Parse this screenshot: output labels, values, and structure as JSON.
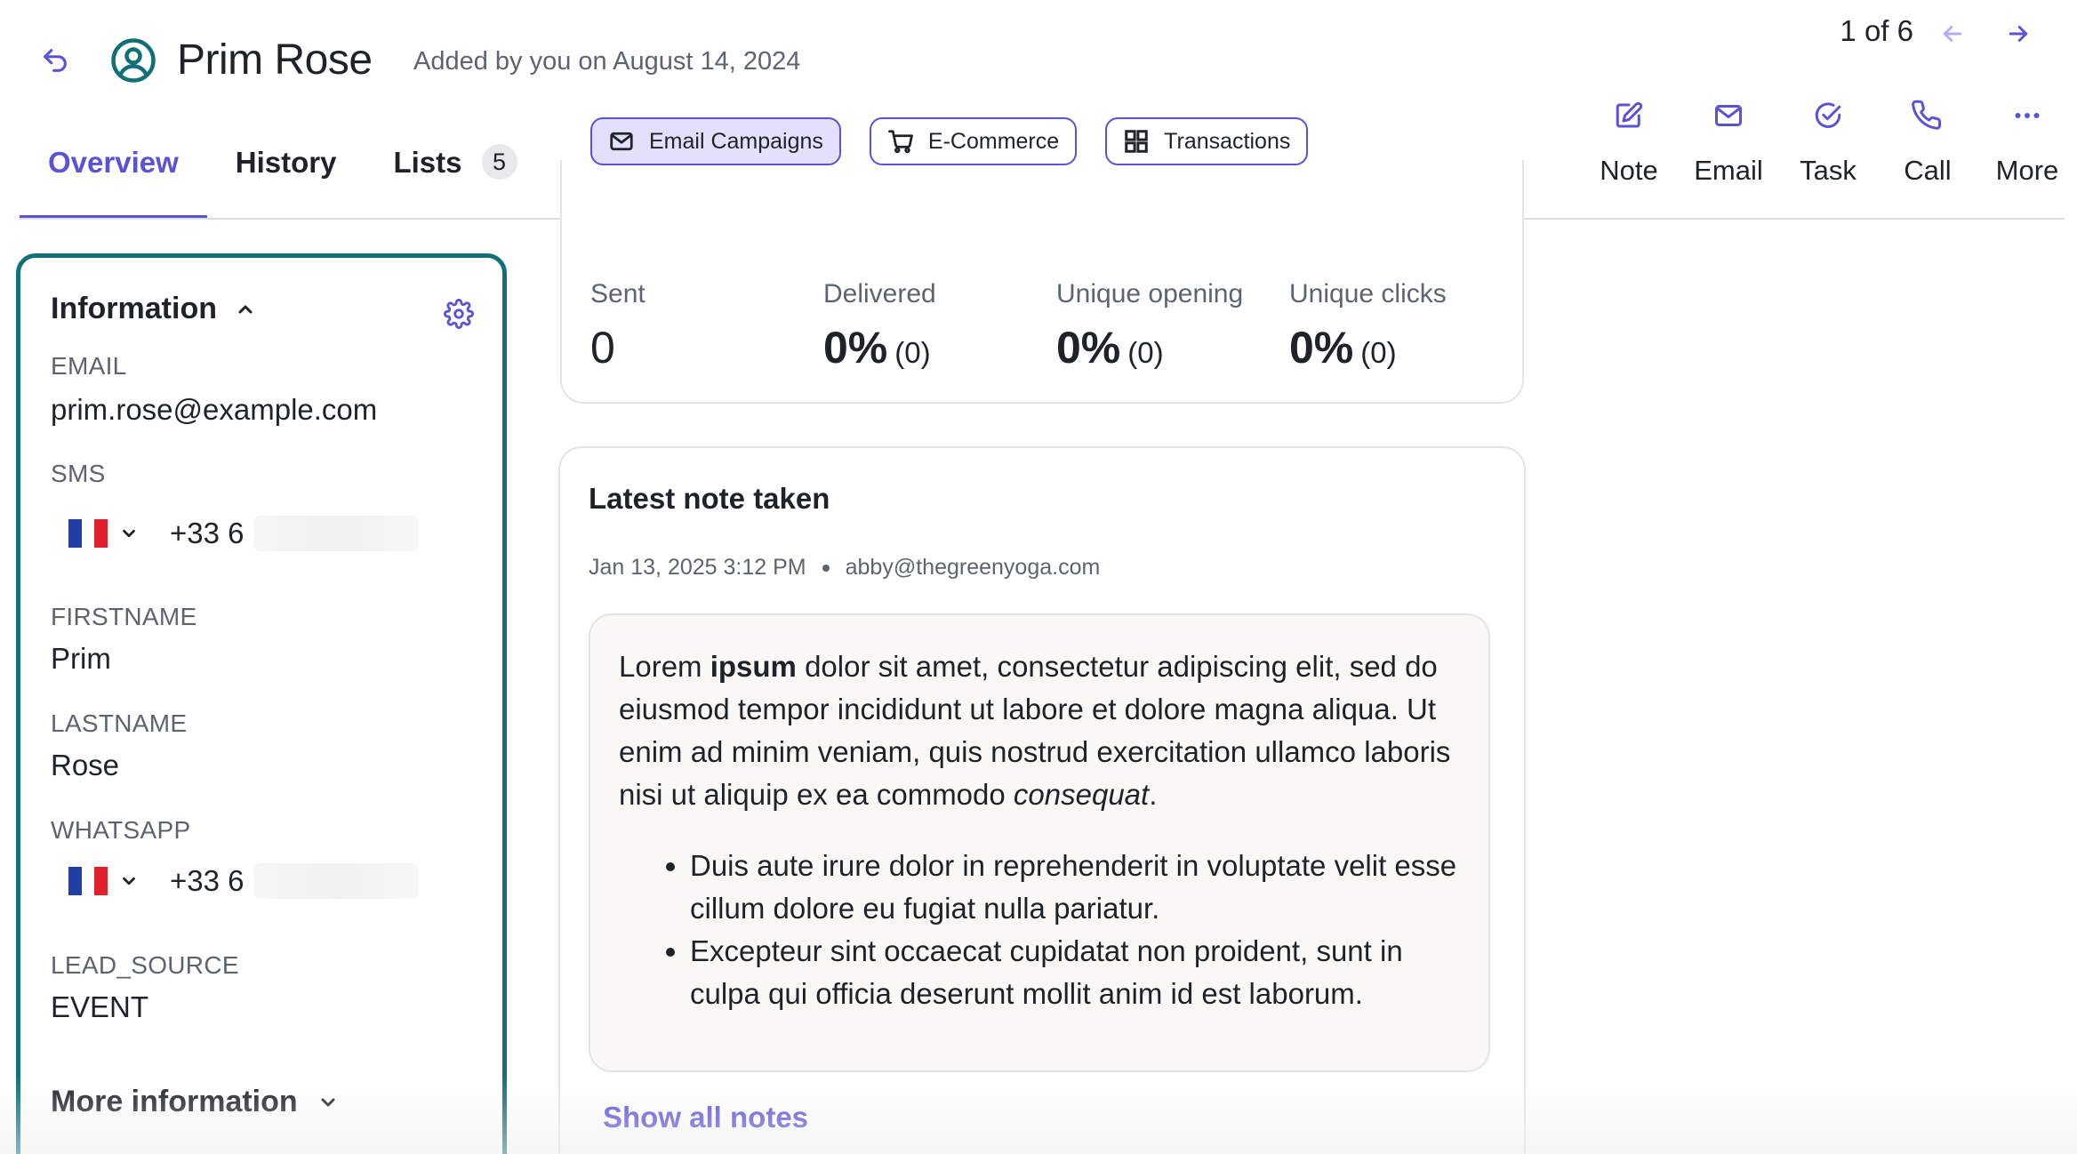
{
  "header": {
    "back_icon": "undo-arrow-icon",
    "avatar_icon": "user-circle-icon",
    "contact_name": "Prim Rose",
    "added_by": "Added by you on August 14, 2024",
    "pager": {
      "text": "1 of 6",
      "prev_icon": "arrow-left-icon",
      "next_icon": "arrow-right-icon"
    }
  },
  "tabs": [
    {
      "label": "Overview",
      "active": true
    },
    {
      "label": "History",
      "active": false
    },
    {
      "label": "Lists",
      "active": false,
      "count": "5"
    }
  ],
  "actions": [
    {
      "label": "Note",
      "icon": "edit-note-icon"
    },
    {
      "label": "Email",
      "icon": "envelope-icon"
    },
    {
      "label": "Task",
      "icon": "check-circle-icon"
    },
    {
      "label": "Call",
      "icon": "phone-icon"
    },
    {
      "label": "More",
      "icon": "more-dots-icon"
    }
  ],
  "info": {
    "title": "Information",
    "fields": {
      "email_label": "EMAIL",
      "email_value": "prim.rose@example.com",
      "sms_label": "SMS",
      "sms_prefix": "+33 6",
      "firstname_label": "FIRSTNAME",
      "firstname_value": "Prim",
      "lastname_label": "LASTNAME",
      "lastname_value": "Rose",
      "whatsapp_label": "WHATSAPP",
      "whatsapp_prefix": "+33 6",
      "lead_source_label": "LEAD_SOURCE",
      "lead_source_value": "EVENT"
    },
    "more_title": "More information"
  },
  "stats": {
    "chips": [
      {
        "label": "Email Campaigns",
        "icon": "envelope-icon",
        "active": true
      },
      {
        "label": "E-Commerce",
        "icon": "cart-icon",
        "active": false
      },
      {
        "label": "Transactions",
        "icon": "grid-icon",
        "active": false
      }
    ],
    "items": [
      {
        "label": "Sent",
        "value": "0",
        "count": ""
      },
      {
        "label": "Delivered",
        "value": "0%",
        "count": "(0)"
      },
      {
        "label": "Unique opening",
        "value": "0%",
        "count": "(0)"
      },
      {
        "label": "Unique clicks",
        "value": "0%",
        "count": "(0)"
      }
    ]
  },
  "note": {
    "title": "Latest note taken",
    "date": "Jan 13, 2025 3:12 PM",
    "author": "abby@thegreenyoga.com",
    "body_part1": "Lorem ",
    "body_bold": "ipsum",
    "body_part2": " dolor sit amet, consectetur adipiscing elit, sed do eiusmod tempor incididunt ut labore et dolore magna aliqua. Ut enim ad minim veniam, quis nostrud exercitation ullamco laboris nisi ut aliquip ex ea commodo ",
    "body_italic": "consequat",
    "body_end": ".",
    "bullets": [
      "Duis aute irure dolor in reprehenderit in voluptate velit esse cillum dolore eu fugiat nulla pariatur.",
      "Excepteur sint occaecat cupidatat non proident, sunt in culpa qui officia deserunt mollit anim id est laborum."
    ],
    "show_all": "Show all notes"
  },
  "colors": {
    "accent": "#5c52d6",
    "panel_border": "#117077",
    "muted_text": "#5e646e"
  }
}
